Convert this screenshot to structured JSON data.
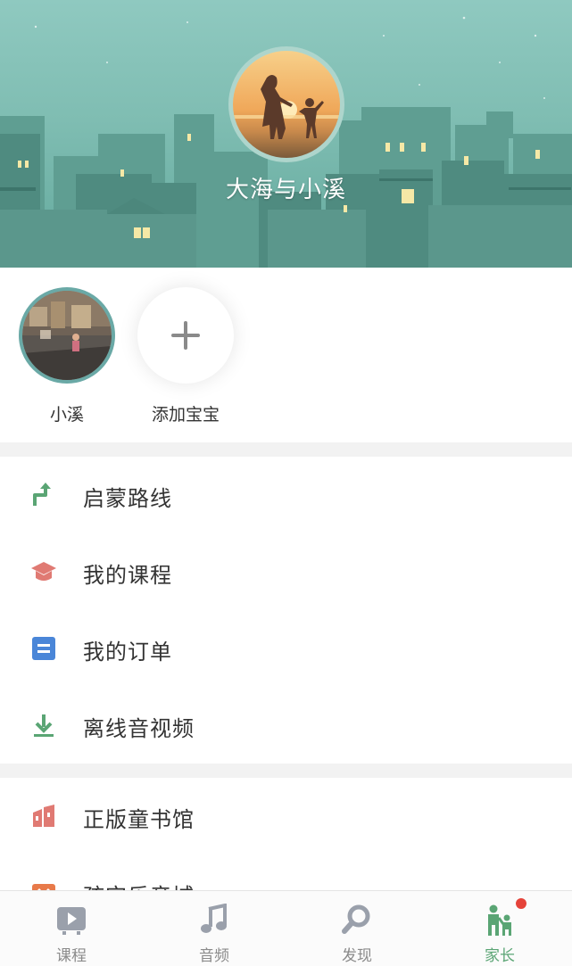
{
  "header": {
    "nickname": "大海与小溪",
    "bg_color": "#7fbdb2"
  },
  "babies": [
    {
      "name": "小溪"
    },
    {
      "name": "添加宝宝"
    }
  ],
  "menu_group_1": [
    {
      "label": "启蒙路线",
      "icon": "route-icon",
      "color": "#5aa574"
    },
    {
      "label": "我的课程",
      "icon": "graduation-cap-icon",
      "color": "#e07a73"
    },
    {
      "label": "我的订单",
      "icon": "order-list-icon",
      "color": "#4a86d8"
    },
    {
      "label": "离线音视频",
      "icon": "download-icon",
      "color": "#5aa574"
    }
  ],
  "menu_group_2": [
    {
      "label": "正版童书馆",
      "icon": "bookshelf-icon",
      "color": "#e07a73"
    },
    {
      "label": "孩宝乐音城",
      "icon": "store-icon",
      "color": "#e87a4a"
    }
  ],
  "tabbar": [
    {
      "label": "课程",
      "icon": "course-icon"
    },
    {
      "label": "音频",
      "icon": "music-note-icon"
    },
    {
      "label": "发现",
      "icon": "discover-search-icon"
    },
    {
      "label": "家长",
      "icon": "parent-child-icon",
      "active": true,
      "badge": true
    }
  ],
  "colors": {
    "accent": "#5aa574",
    "badge": "#e5433a"
  }
}
